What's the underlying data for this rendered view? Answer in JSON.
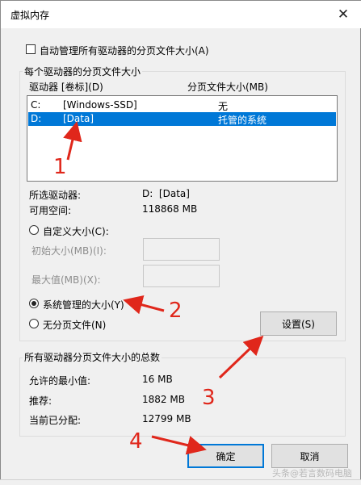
{
  "window": {
    "title": "虚拟内存",
    "close_glyph": "✕"
  },
  "auto_manage": {
    "label": "自动管理所有驱动器的分页文件大小(A)",
    "checked": false
  },
  "per_drive": {
    "group_title": "每个驱动器的分页文件大小",
    "col_drive": "驱动器 [卷标](D)",
    "col_size": "分页文件大小(MB)",
    "rows": [
      {
        "drive": "C:",
        "label": "[Windows-SSD]",
        "size": "无",
        "selected": false
      },
      {
        "drive": "D:",
        "label": "[Data]",
        "size": "托管的系统",
        "selected": true
      }
    ],
    "selected_drive_label": "所选驱动器:",
    "selected_drive_value": "D:  [Data]",
    "free_space_label": "可用空间:",
    "free_space_value": "118868 MB",
    "custom_size": "自定义大小(C):",
    "initial_size": "初始大小(MB)(I):",
    "max_size": "最大值(MB)(X):",
    "system_managed": "系统管理的大小(Y)",
    "no_paging": "无分页文件(N)",
    "set_button": "设置(S)"
  },
  "totals": {
    "group_title": "所有驱动器分页文件大小的总数",
    "min_label": "允许的最小值:",
    "min_value": "16 MB",
    "recommended_label": "推荐:",
    "recommended_value": "1882 MB",
    "allocated_label": "当前已分配:",
    "allocated_value": "12799 MB"
  },
  "buttons": {
    "ok": "确定",
    "cancel": "取消"
  },
  "annotations": {
    "n1": "1",
    "n2": "2",
    "n3": "3",
    "n4": "4",
    "annotation_color": "#e0271b"
  },
  "watermark": "头条@若言数码电脑"
}
